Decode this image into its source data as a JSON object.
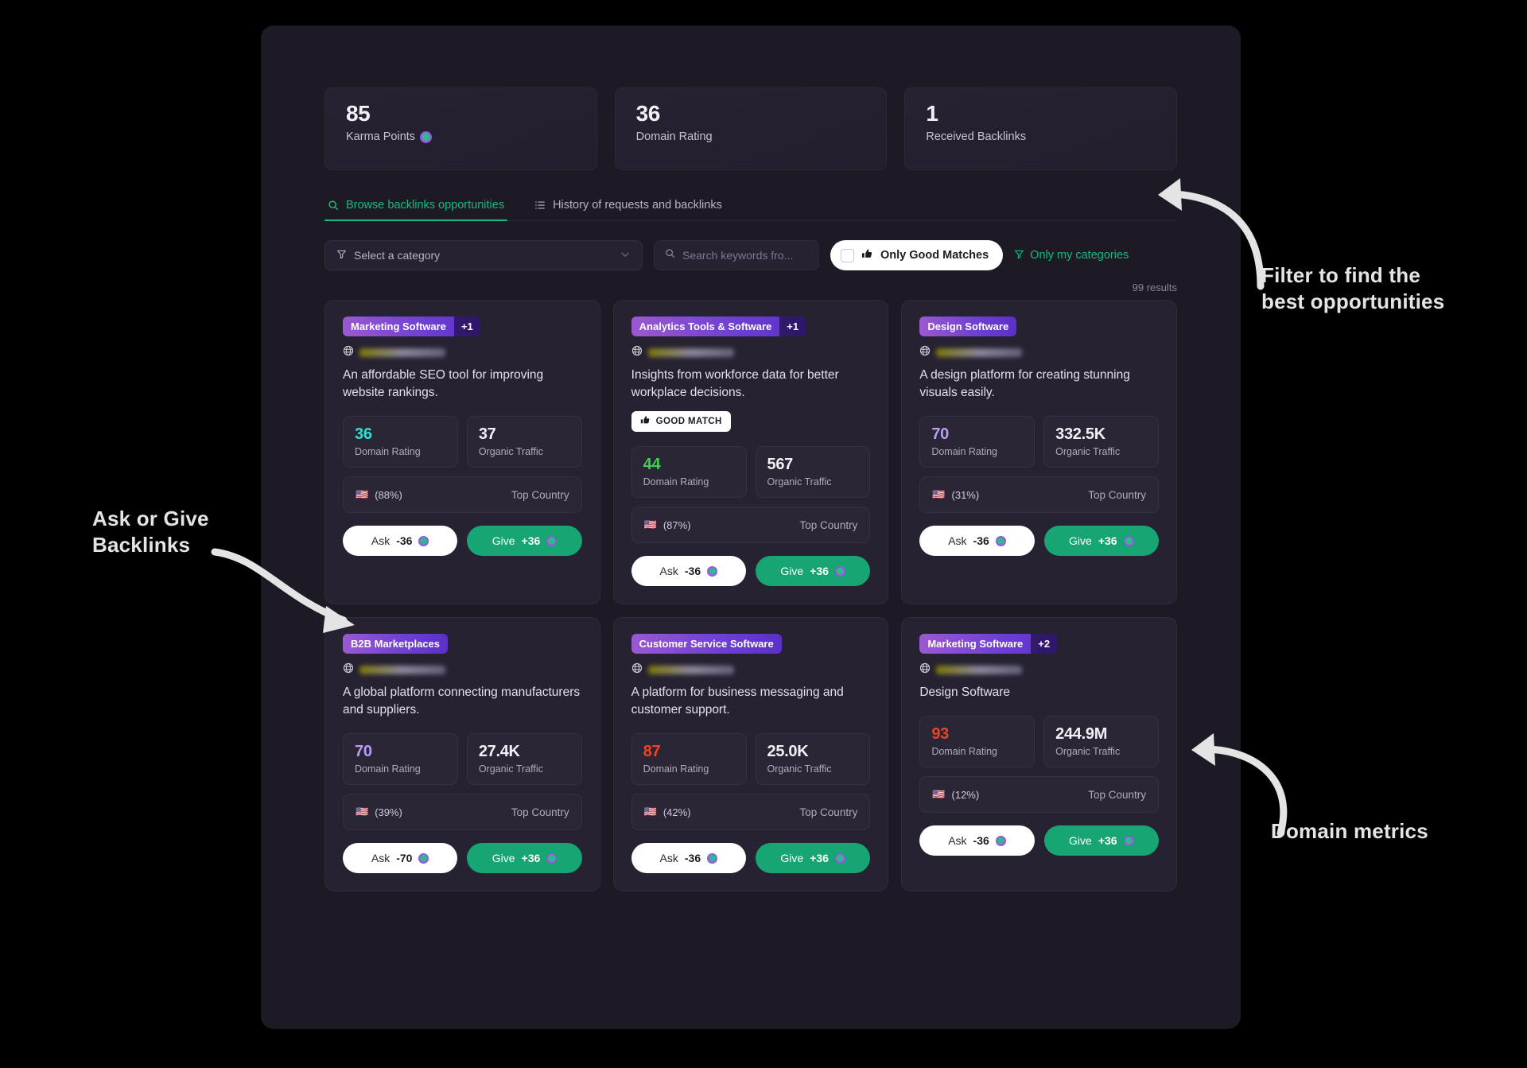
{
  "stats": [
    {
      "value": "85",
      "label": "Karma Points",
      "has_karma_icon": true
    },
    {
      "value": "36",
      "label": "Domain Rating",
      "has_karma_icon": false
    },
    {
      "value": "1",
      "label": "Received Backlinks",
      "has_karma_icon": false
    }
  ],
  "tabs": [
    {
      "label": "Browse backlinks opportunities",
      "icon": "search-icon",
      "active": true
    },
    {
      "label": "History of requests and backlinks",
      "icon": "list-icon",
      "active": false
    }
  ],
  "filters": {
    "category_placeholder": "Select a category",
    "category_icon": "filter-icon",
    "search_placeholder": "Search keywords fro...",
    "search_value": "",
    "search_icon": "search-icon",
    "good_matches_label": "Only Good Matches",
    "good_matches_icon": "thumbs-up-icon",
    "good_matches_checked": false,
    "only_my_categories_label": "Only my categories",
    "only_my_categories_icon": "filter-icon",
    "results_count": "99 results"
  },
  "colors": {
    "accent_green": "#17b97d",
    "give_green": "#17a573",
    "badge_purple": "#6d3fd4",
    "dr_cyan": "#2ee0d0",
    "dr_green": "#3ad14f",
    "dr_purple": "#bb9bf5",
    "dr_red": "#f04322",
    "card_bg": "#262231",
    "window_bg": "#1d1a25"
  },
  "cards": [
    {
      "category": "Marketing Software",
      "extra_count": "+1",
      "domain": "",
      "description": "An affordable SEO tool for improving website rankings.",
      "good_match": false,
      "good_match_label": "GOOD MATCH",
      "domain_rating": "36",
      "domain_rating_color": "#2ee0d0",
      "domain_rating_label": "Domain Rating",
      "organic_traffic": "37",
      "organic_traffic_label": "Organic Traffic",
      "country_flag": "🇺🇸",
      "country_pct": "(88%)",
      "country_label": "Top Country",
      "ask_label": "Ask",
      "ask_amount": "-36",
      "give_label": "Give",
      "give_amount": "+36"
    },
    {
      "category": "Analytics Tools & Software",
      "extra_count": "+1",
      "domain": "",
      "description": "Insights from workforce data for better workplace decisions.",
      "good_match": true,
      "good_match_label": "GOOD MATCH",
      "domain_rating": "44",
      "domain_rating_color": "#3ad14f",
      "domain_rating_label": "Domain Rating",
      "organic_traffic": "567",
      "organic_traffic_label": "Organic Traffic",
      "country_flag": "🇺🇸",
      "country_pct": "(87%)",
      "country_label": "Top Country",
      "ask_label": "Ask",
      "ask_amount": "-36",
      "give_label": "Give",
      "give_amount": "+36"
    },
    {
      "category": "Design Software",
      "extra_count": "",
      "domain": "",
      "description": "A design platform for creating stunning visuals easily.",
      "good_match": false,
      "good_match_label": "GOOD MATCH",
      "domain_rating": "70",
      "domain_rating_color": "#bb9bf5",
      "domain_rating_label": "Domain Rating",
      "organic_traffic": "332.5K",
      "organic_traffic_label": "Organic Traffic",
      "country_flag": "🇺🇸",
      "country_pct": "(31%)",
      "country_label": "Top Country",
      "ask_label": "Ask",
      "ask_amount": "-36",
      "give_label": "Give",
      "give_amount": "+36"
    },
    {
      "category": "B2B Marketplaces",
      "extra_count": "",
      "domain": "",
      "description": "A global platform connecting manufacturers and suppliers.",
      "good_match": false,
      "good_match_label": "GOOD MATCH",
      "domain_rating": "70",
      "domain_rating_color": "#bb9bf5",
      "domain_rating_label": "Domain Rating",
      "organic_traffic": "27.4K",
      "organic_traffic_label": "Organic Traffic",
      "country_flag": "🇺🇸",
      "country_pct": "(39%)",
      "country_label": "Top Country",
      "ask_label": "Ask",
      "ask_amount": "-70",
      "give_label": "Give",
      "give_amount": "+36"
    },
    {
      "category": "Customer Service Software",
      "extra_count": "",
      "domain": "",
      "description": "A platform for business messaging and customer support.",
      "good_match": false,
      "good_match_label": "GOOD MATCH",
      "domain_rating": "87",
      "domain_rating_color": "#f04322",
      "domain_rating_label": "Domain Rating",
      "organic_traffic": "25.0K",
      "organic_traffic_label": "Organic Traffic",
      "country_flag": "🇺🇸",
      "country_pct": "(42%)",
      "country_label": "Top Country",
      "ask_label": "Ask",
      "ask_amount": "-36",
      "give_label": "Give",
      "give_amount": "+36"
    },
    {
      "category": "Marketing Software",
      "extra_count": "+2",
      "domain": "",
      "description": "Design Software",
      "good_match": false,
      "good_match_label": "GOOD MATCH",
      "domain_rating": "93",
      "domain_rating_color": "#f04322",
      "domain_rating_label": "Domain Rating",
      "organic_traffic": "244.9M",
      "organic_traffic_label": "Organic Traffic",
      "country_flag": "🇺🇸",
      "country_pct": "(12%)",
      "country_label": "Top Country",
      "ask_label": "Ask",
      "ask_amount": "-36",
      "give_label": "Give",
      "give_amount": "+36"
    }
  ],
  "annotations": [
    {
      "id": "filter-annotation",
      "line1": "Filter to find the",
      "line2": "best opportunities"
    },
    {
      "id": "ask-give-annotation",
      "line1": "Ask or Give",
      "line2": "Backlinks"
    },
    {
      "id": "domain-metrics-annotation",
      "line1": "Domain metrics",
      "line2": ""
    }
  ]
}
